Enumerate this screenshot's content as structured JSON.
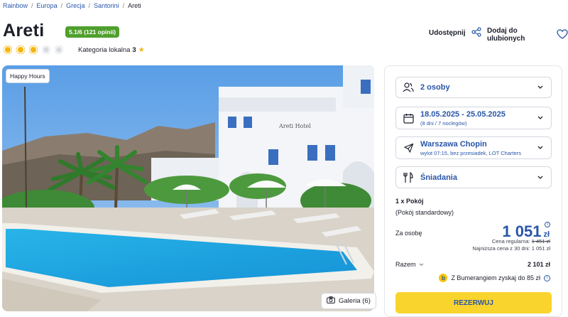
{
  "breadcrumb": [
    "Rainbow",
    "Europa",
    "Grecja",
    "Santorini",
    "Areti"
  ],
  "hotel": {
    "name": "Areti",
    "rating_badge": "5.1/6 (121 opinii)",
    "suns_total": 5,
    "suns_filled": 3,
    "local_category_label": "Kategoria lokalna",
    "local_category_value": "3",
    "local_category_icon": "star-icon"
  },
  "actions": {
    "share_label": "Udostępnij",
    "share_icon": "share-icon",
    "favorite_label": "Dodaj do ulubionych",
    "favorite_icon": "heart-icon"
  },
  "photo": {
    "badge": "Happy Hours",
    "gallery_label": "Galeria (6)",
    "gallery_icon": "camera-icon"
  },
  "booking": {
    "persons": {
      "label": "2 osoby",
      "icon": "people-icon"
    },
    "dates": {
      "label": "18.05.2025 - 25.05.2025",
      "sub": "(8 dni / 7 noclegów)",
      "icon": "calendar-icon"
    },
    "flight": {
      "label": "Warszawa Chopin",
      "sub": "wylot 07:15, bez przesiadek, LOT Charters",
      "icon": "plane-icon"
    },
    "board": {
      "label": "Śniadania",
      "icon": "cutlery-icon"
    },
    "room_count": "1 x Pokój",
    "room_type": "(Pokój standardowy)",
    "per_person_label": "Za osobę",
    "per_person_price": "1 051",
    "currency": "zł",
    "regular_label": "Cena regularna:",
    "regular_price": "1 451 zł",
    "lowest_label": "Najniższa cena z 30 dni:",
    "lowest_price": "1 051 zł",
    "total_label": "Razem",
    "total_value": "2 101 zł",
    "bumerang_text": "Z Bumerangiem zyskaj do 85 zł",
    "book_label": "REZERWUJ"
  },
  "colors": {
    "brand_blue": "#2856a8",
    "rating_green": "#4f9f2c",
    "sun_yellow": "#f3b50e",
    "button_yellow": "#f9d42d"
  }
}
